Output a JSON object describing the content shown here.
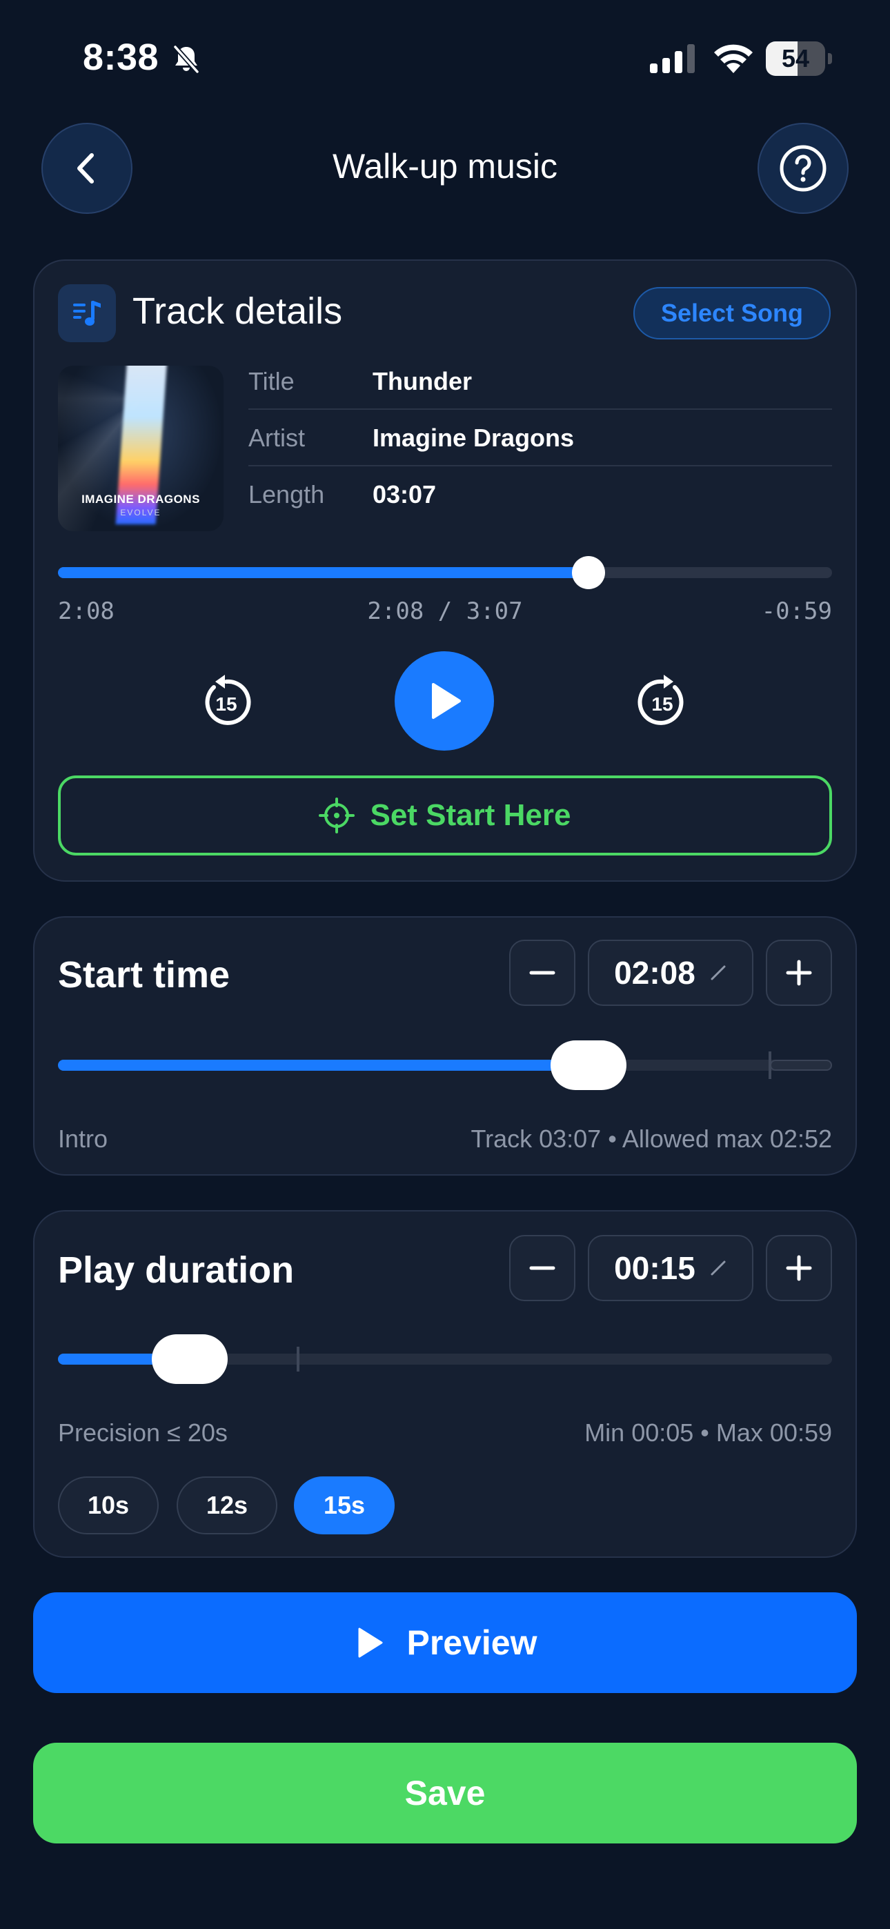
{
  "status_bar": {
    "time": "8:38",
    "battery": "54",
    "battery_level": 0.54
  },
  "header": {
    "title": "Walk-up music"
  },
  "track_details": {
    "heading": "Track details",
    "select_button": "Select Song",
    "album_art_text": "IMAGINE DRAGONS",
    "album_art_subtext": "EVOLVE",
    "fields": [
      {
        "label": "Title",
        "value": "Thunder"
      },
      {
        "label": "Artist",
        "value": "Imagine Dragons"
      },
      {
        "label": "Length",
        "value": "03:07"
      }
    ],
    "progress": {
      "elapsed": "2:08",
      "position": "2:08 / 3:07",
      "remaining": "-0:59",
      "fraction": 0.685
    },
    "skip_back_label": "15",
    "skip_forward_label": "15",
    "set_start_label": "Set Start Here"
  },
  "start_time": {
    "heading": "Start time",
    "value": "02:08",
    "slider_fraction": 0.685,
    "allowed_max_fraction": 0.92,
    "left_hint": "Intro",
    "right_hint": "Track 03:07 • Allowed max 02:52"
  },
  "play_duration": {
    "heading": "Play duration",
    "value": "00:15",
    "slider_fraction": 0.17,
    "marker_fraction": 0.31,
    "left_hint": "Precision ≤ 20s",
    "right_hint": "Min 00:05 • Max 00:59",
    "presets": [
      {
        "label": "10s",
        "active": false
      },
      {
        "label": "12s",
        "active": false
      },
      {
        "label": "15s",
        "active": true
      }
    ]
  },
  "actions": {
    "preview": "Preview",
    "save": "Save"
  },
  "colors": {
    "accent": "#1a7bff",
    "success": "#4cd964",
    "background": "#0b1526",
    "card": "#151f31"
  }
}
